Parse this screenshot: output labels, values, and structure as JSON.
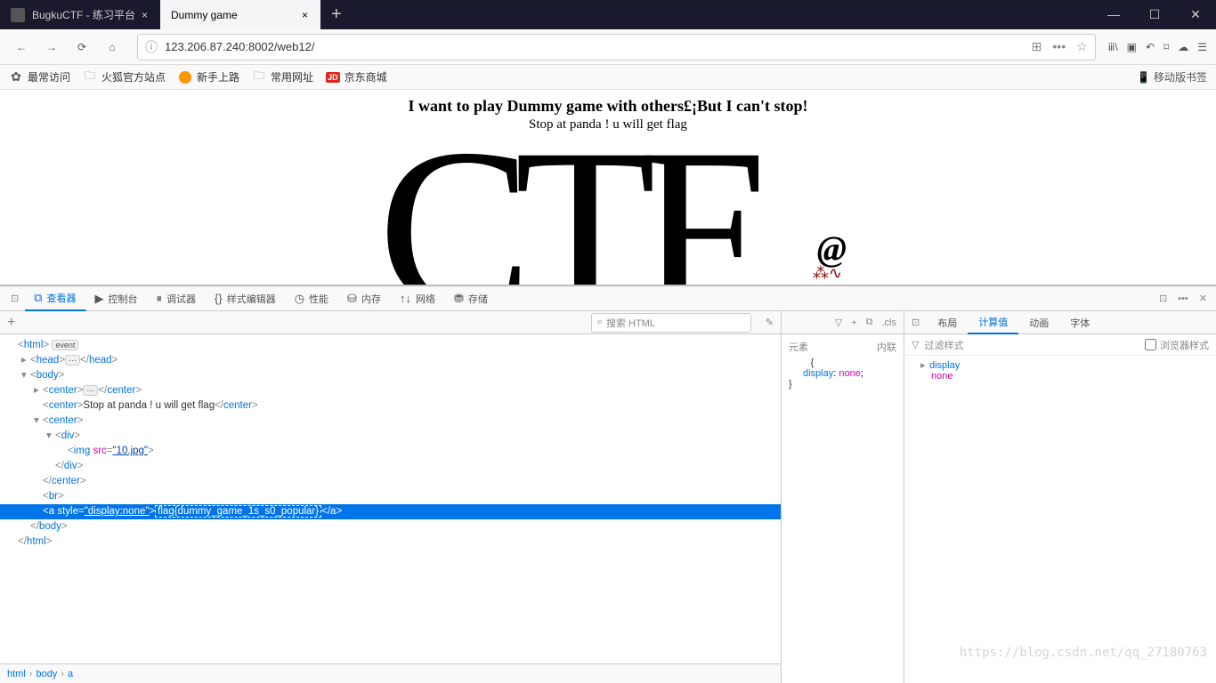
{
  "tabs": {
    "items": [
      {
        "title": "BugkuCTF - 练习平台",
        "active": false
      },
      {
        "title": "Dummy game",
        "active": true
      }
    ]
  },
  "nav": {
    "url": "123.206.87.240:8002/web12/"
  },
  "bookmarks": {
    "items": [
      {
        "label": "最常访问",
        "icon": "gear"
      },
      {
        "label": "火狐官方站点",
        "icon": "folder"
      },
      {
        "label": "新手上路",
        "icon": "firefox"
      },
      {
        "label": "常用网址",
        "icon": "folder"
      },
      {
        "label": "京东商城",
        "icon": "jd"
      }
    ],
    "mobile": "移动版书签"
  },
  "page": {
    "heading": "I want to play Dummy game with others£¡But I can't stop!",
    "sub": "Stop at panda ! u will get flag",
    "big": "CTF",
    "at": "@"
  },
  "devtools": {
    "tabs": [
      {
        "label": "查看器",
        "icon": "⧉",
        "active": true
      },
      {
        "label": "控制台",
        "icon": "▶",
        "active": false
      },
      {
        "label": "调试器",
        "icon": "⏸",
        "active": false
      },
      {
        "label": "样式编辑器",
        "icon": "{}",
        "active": false
      },
      {
        "label": "性能",
        "icon": "◷",
        "active": false
      },
      {
        "label": "内存",
        "icon": "⛁",
        "active": false
      },
      {
        "label": "网络",
        "icon": "↑↓",
        "active": false
      },
      {
        "label": "存储",
        "icon": "⛃",
        "active": false
      }
    ],
    "search_placeholder": "搜索 HTML",
    "dom": {
      "lines": [
        {
          "indent": 0,
          "pre": "",
          "html": "<html>",
          "event": true
        },
        {
          "indent": 1,
          "pre": "▸",
          "html": "<head>…</head>"
        },
        {
          "indent": 1,
          "pre": "▾",
          "html": "<body>"
        },
        {
          "indent": 2,
          "pre": "▸",
          "html": "<center>…</center>"
        },
        {
          "indent": 2,
          "pre": "",
          "html": "<center>Stop at panda ! u will get flag</center>"
        },
        {
          "indent": 2,
          "pre": "▾",
          "html": "<center>"
        },
        {
          "indent": 3,
          "pre": "▾",
          "html": "<div>"
        },
        {
          "indent": 4,
          "pre": "",
          "html": "<img src=\"10.jpg\">"
        },
        {
          "indent": 3,
          "pre": "",
          "html": "</div>"
        },
        {
          "indent": 2,
          "pre": "",
          "html": "</center>"
        },
        {
          "indent": 2,
          "pre": "",
          "html": "<br>"
        },
        {
          "indent": 2,
          "pre": "",
          "html": "<a style=\"display:none\">flag{dummy_game_1s_s0_popular}</a>",
          "selected": true
        },
        {
          "indent": 1,
          "pre": "",
          "html": "</body>"
        },
        {
          "indent": 0,
          "pre": "",
          "html": "</html>"
        }
      ]
    },
    "styles": {
      "element_label": "元素",
      "inline_label": "内联",
      "rule": {
        "prop": "display",
        "val": "none"
      }
    },
    "computed": {
      "tabs": [
        "布局",
        "计算值",
        "动画",
        "字体"
      ],
      "active_tab": "计算值",
      "filter_placeholder": "过滤样式",
      "browser_styles": "浏览器样式",
      "props": [
        {
          "name": "display",
          "value": ""
        },
        {
          "name": "none",
          "value": "",
          "is_val": true
        }
      ]
    },
    "styles_toolbar": {
      "cls": ".cls"
    },
    "breadcrumb": [
      "html",
      "body",
      "a"
    ]
  },
  "watermark": "https://blog.csdn.net/qq_27180763"
}
